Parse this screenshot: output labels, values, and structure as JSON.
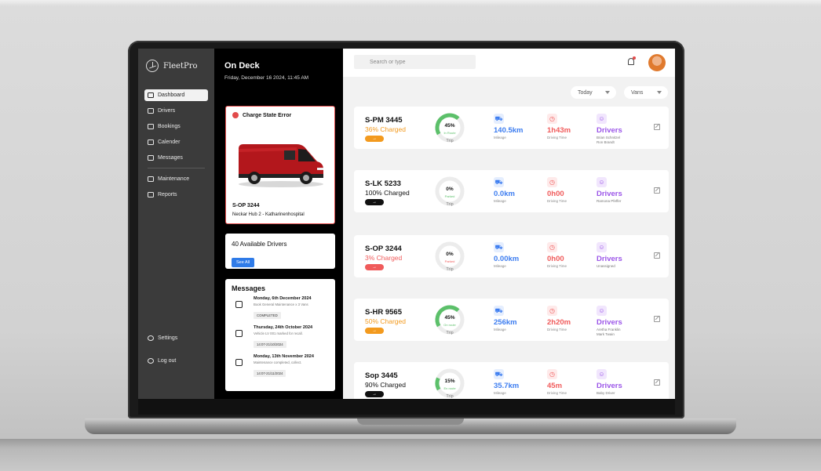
{
  "app": {
    "brand": "FleetPro"
  },
  "sidebar": {
    "items": [
      {
        "label": "Dashboard",
        "icon": "grid-icon"
      },
      {
        "label": "Drivers",
        "icon": "users-icon"
      },
      {
        "label": "Bookings",
        "icon": "car-icon"
      },
      {
        "label": "Calender",
        "icon": "calendar-icon"
      },
      {
        "label": "Messages",
        "icon": "message-icon"
      },
      {
        "label": "Maintenance",
        "icon": "wrench-icon"
      },
      {
        "label": "Reports",
        "icon": "folder-icon"
      }
    ],
    "bottom": [
      {
        "label": "Settings",
        "icon": "gear-icon"
      },
      {
        "label": "Log out",
        "icon": "logout-icon"
      }
    ]
  },
  "deck": {
    "title": "On Deck",
    "date": "Friday, December 16 2024, 11:45 AM",
    "error": {
      "title": "Charge State Error",
      "plate": "S-OP 3244",
      "location": "Neckar Hub 2 - Katharinenhospital"
    },
    "drivers": {
      "title": "40 Available Drivers",
      "button": "See All"
    },
    "messages": {
      "title": "Messages",
      "items": [
        {
          "date": "Monday, 6th December 2024",
          "text": "Book General Maintenance x 3 Vans",
          "tag": "COMPLETED",
          "icon": "chat-icon"
        },
        {
          "date": "Thursday, 24th October 2024",
          "text": "Vehicle LV 001 marked for recall.",
          "tag": "14:07-21/10/2024",
          "icon": "clipboard-icon"
        },
        {
          "date": "Monday, 13th November 2024",
          "text": "Maintenance completed, collect.",
          "tag": "14:07-21/11/2024",
          "icon": "wrench-icon"
        }
      ]
    }
  },
  "topbar": {
    "search_placeholder": "Search or type"
  },
  "filters": {
    "period": "Today",
    "vehicle": "Vans"
  },
  "colors": {
    "orange": "#f39a1e",
    "red": "#f05b5b",
    "green": "#5cc06a",
    "blue": "#3d7df0",
    "purple": "#9b55e8",
    "black": "#111111"
  },
  "vehicles": [
    {
      "plate": "S-PM 3445",
      "charge": "36% Charged",
      "charge_color": "orange",
      "button_color": "orange",
      "button": "→",
      "trip_pct": "45%",
      "trip_value": 0.45,
      "status": "In Route",
      "status_color": "green",
      "trip": "Trip",
      "mileage": "140.5km",
      "mileage_label": "Mileage",
      "driving": "1h43m",
      "driving_label": "Driving Time",
      "drivers_label": "Drivers",
      "drivers": [
        "Brian Schnitzel",
        "Ron Brandt"
      ]
    },
    {
      "plate": "S-LK 5233",
      "charge": "100% Charged",
      "charge_color": "black",
      "button_color": "black",
      "button": "→",
      "trip_pct": "0%",
      "trip_value": 0,
      "status": "Parked",
      "status_color": "green",
      "trip": "Trip",
      "mileage": "0.0km",
      "mileage_label": "Mileage",
      "driving": "0h00",
      "driving_label": "Driving Time",
      "drivers_label": "Drivers",
      "drivers": [
        "Ramona Pfeffer"
      ]
    },
    {
      "plate": "S-OP 3244",
      "charge": "3% Charged",
      "charge_color": "red",
      "button_color": "red",
      "button": "→",
      "trip_pct": "0%",
      "trip_value": 0,
      "status": "Parked",
      "status_color": "red",
      "trip": "Trip",
      "mileage": "0.00km",
      "mileage_label": "Mileage",
      "driving": "0h00",
      "driving_label": "Driving Time",
      "drivers_label": "Drivers",
      "drivers": [
        "Unassigned"
      ]
    },
    {
      "plate": "S-HR 9565",
      "charge": "50% Charged",
      "charge_color": "orange",
      "button_color": "orange",
      "button": "→",
      "trip_pct": "45%",
      "trip_value": 0.45,
      "status": "On route",
      "status_color": "green",
      "trip": "Trip",
      "mileage": "256km",
      "mileage_label": "Mileage",
      "driving": "2h20m",
      "driving_label": "Driving Time",
      "drivers_label": "Drivers",
      "drivers": [
        "Aretha Franklin",
        "Mark Twain"
      ]
    },
    {
      "plate": "Sop 3445",
      "charge": "90% Charged",
      "charge_color": "black",
      "button_color": "black",
      "button": "→",
      "trip_pct": "15%",
      "trip_value": 0.15,
      "status": "En route",
      "status_color": "green",
      "trip": "Trip",
      "mileage": "35.7km",
      "mileage_label": "Mileage",
      "driving": "45m",
      "driving_label": "Driving Time",
      "drivers_label": "Drivers",
      "drivers": [
        "Baby Driver"
      ]
    }
  ]
}
